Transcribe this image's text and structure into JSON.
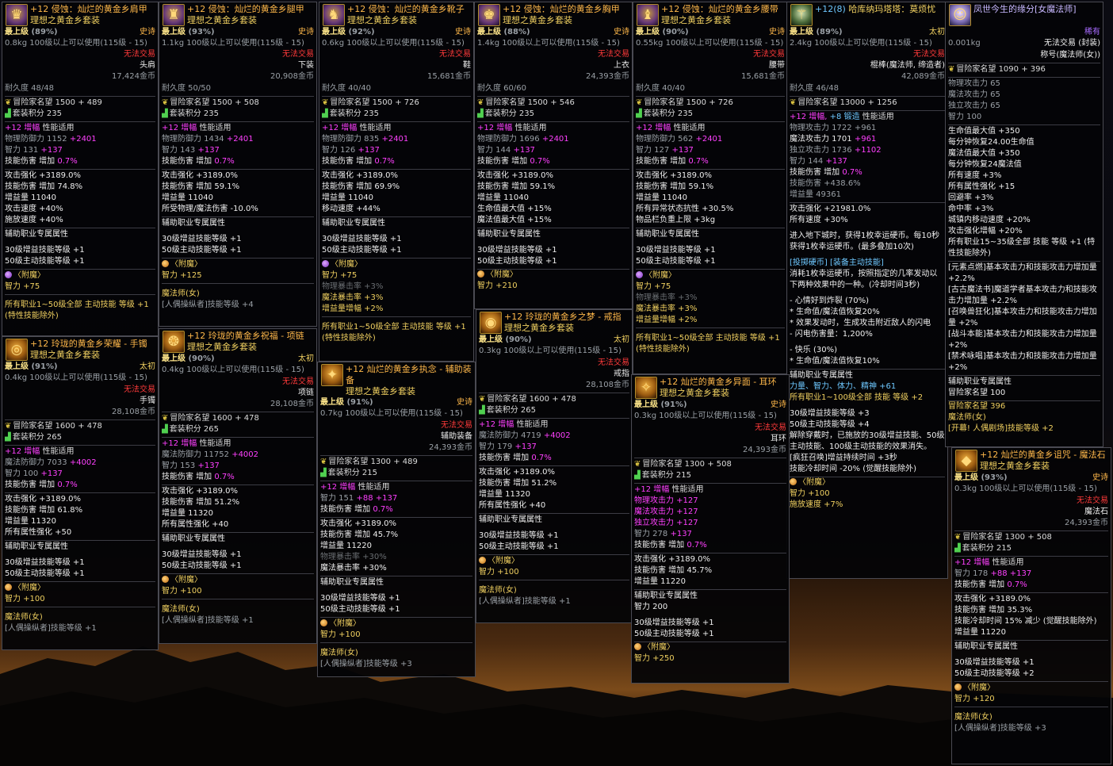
{
  "shoulder": {
    "name": "+12 侵蚀：灿烂的黄金乡肩甲",
    "set": "理想之黄金乡套装",
    "grade": "最上级",
    "grade_pct": "(89%)",
    "rarity": "史诗",
    "weight": "0.8kg",
    "req": "100级以上可以使用(115级 - 15)",
    "trade": "无法交易",
    "slot": "头肩",
    "price": "17,424金币",
    "dur": "耐久度 48/48",
    "fame": "冒险家名望 1500 + 489",
    "setpts": "套装积分 235",
    "amp_a": "+12 增幅",
    "amp_b": "性能适用",
    "def_l": "物理防御力 1152",
    "def_b": "+2401",
    "int_l": "智力 131",
    "int_b": "+137",
    "skd_l": "技能伤害 增加",
    "skd_b": "0.7%",
    "s1": "攻击强化 +3189.0%",
    "s2": "技能伤害 增加 74.8%",
    "s3": "增益量 11040",
    "s4": "攻击速度 +40%",
    "s5": "施放速度 +40%",
    "aux": "辅助职业专属属性",
    "b1": "30级增益技能等级 +1",
    "b2": "50级主动技能等级 +1",
    "ench": "〈附魔〉",
    "ench_v": "智力 +75",
    "all": "所有职业1~50级全部 主动技能 等级 +1 (特性技能除外)"
  },
  "legs": {
    "name": "+12 侵蚀：灿烂的黄金乡腿甲",
    "set": "理想之黄金乡套装",
    "grade": "最上级",
    "grade_pct": "(93%)",
    "rarity": "史诗",
    "weight": "1.1kg",
    "req": "100级以上可以使用(115级 - 15)",
    "trade": "无法交易",
    "slot": "下装",
    "price": "20,908金币",
    "dur": "耐久度 50/50",
    "fame": "冒险家名望 1500 + 508",
    "setpts": "套装积分 235",
    "amp_a": "+12 增幅",
    "amp_b": "性能适用",
    "def_l": "物理防御力 1434",
    "def_b": "+2401",
    "int_l": "智力 143",
    "int_b": "+137",
    "skd_l": "技能伤害 增加",
    "skd_b": "0.7%",
    "s1": "攻击强化 +3189.0%",
    "s2": "技能伤害 增加 59.1%",
    "s3": "增益量 11040",
    "s4": "所受物理/魔法伤害 -10.0%",
    "aux": "辅助职业专属属性",
    "b1": "30级增益技能等级 +1",
    "b2": "50级主动技能等级 +1",
    "ench": "〈附魔〉",
    "ench_v": "智力 +125",
    "job": "魔法师(女)",
    "job2": "[人偶操纵者]技能等级 +4"
  },
  "shoes": {
    "name": "+12 侵蚀：灿烂的黄金乡靴子",
    "set": "理想之黄金乡套装",
    "grade": "最上级",
    "grade_pct": "(92%)",
    "rarity": "史诗",
    "weight": "0.6kg",
    "req": "100级以上可以使用(115级 - 15)",
    "trade": "无法交易",
    "slot": "鞋",
    "price": "15,681金币",
    "dur": "耐久度 40/40",
    "fame": "冒险家名望 1500 + 726",
    "setpts": "套装积分 235",
    "amp_a": "+12 增幅",
    "amp_b": "性能适用",
    "def_l": "物理防御力 835",
    "def_b": "+2401",
    "int_l": "智力 126",
    "int_b": "+137",
    "skd_l": "技能伤害 增加",
    "skd_b": "0.7%",
    "s1": "攻击强化 +3189.0%",
    "s2": "技能伤害 增加 69.9%",
    "s3": "增益量 11040",
    "s4": "移动速度 +44%",
    "aux": "辅助职业专属属性",
    "b1": "30级增益技能等级 +1",
    "b2": "50级主动技能等级 +1",
    "ench": "〈附魔〉",
    "ench_v": "智力 +75",
    "e2": "物理暴击率 +3%",
    "e3": "魔法暴击率 +3%",
    "e4": "增益量增幅 +2%",
    "all": "所有职业1~50级全部 主动技能 等级 +1 (特性技能除外)"
  },
  "chest": {
    "name": "+12 侵蚀：灿烂的黄金乡胸甲",
    "set": "理想之黄金乡套装",
    "grade": "最上级",
    "grade_pct": "(88%)",
    "rarity": "史诗",
    "weight": "1.4kg",
    "req": "100级以上可以使用(115级 - 15)",
    "trade": "无法交易",
    "slot": "上衣",
    "price": "24,393金币",
    "dur": "耐久度 60/60",
    "fame": "冒险家名望 1500 + 546",
    "setpts": "套装积分 235",
    "amp_a": "+12 增幅",
    "amp_b": "性能适用",
    "def_l": "物理防御力 1696",
    "def_b": "+2401",
    "int_l": "智力 144",
    "int_b": "+137",
    "skd_l": "技能伤害 增加",
    "skd_b": "0.7%",
    "s1": "攻击强化 +3189.0%",
    "s2": "技能伤害 增加 59.1%",
    "s3": "增益量 11040",
    "s4": "生命值最大值 +15%",
    "s5": "魔法值最大值 +15%",
    "aux": "辅助职业专属属性",
    "b1": "30级增益技能等级 +1",
    "b2": "50级主动技能等级 +1",
    "ench": "〈附魔〉",
    "ench_v": "智力 +210"
  },
  "belt": {
    "name": "+12 侵蚀：灿烂的黄金乡腰带",
    "set": "理想之黄金乡套装",
    "grade": "最上级",
    "grade_pct": "(90%)",
    "rarity": "史诗",
    "weight": "0.55kg",
    "req": "100级以上可以使用(115级 - 15)",
    "trade": "无法交易",
    "slot": "腰带",
    "price": "15,681金币",
    "dur": "耐久度 40/40",
    "fame": "冒险家名望 1500 + 726",
    "setpts": "套装积分 235",
    "amp_a": "+12 增幅",
    "amp_b": "性能适用",
    "def_l": "物理防御力 562",
    "def_b": "+2401",
    "int_l": "智力 127",
    "int_b": "+137",
    "skd_l": "技能伤害 增加",
    "skd_b": "0.7%",
    "s1": "攻击强化 +3189.0%",
    "s2": "技能伤害 增加 59.1%",
    "s3": "增益量 11040",
    "s4": "所有异常状态抗性 +30.5%",
    "s5": "物品栏负重上限 +3kg",
    "aux": "辅助职业专属属性",
    "b1": "30级增益技能等级 +1",
    "b2": "50级主动技能等级 +1",
    "ench": "〈附魔〉",
    "ench_v": "智力 +75",
    "e2": "物理暴击率 +3%",
    "e3": "魔法暴击率 +3%",
    "e4": "增益量增幅 +2%",
    "all": "所有职业1~50级全部 主动技能 等级 +1 (特性技能除外)"
  },
  "weapon": {
    "name_a": "+12(8)",
    "name_b": "哈库纳玛塔塔：莫烦忧",
    "grade": "最上级",
    "grade_pct": "(89%)",
    "rarity": "太初",
    "weight": "2.4kg",
    "req": "100级以上可以使用(115级 - 15)",
    "trade": "无法交易",
    "slot": "棍棒(魔法师, 缔造者)",
    "price": "42,089金币",
    "dur": "耐久度 46/48",
    "fame": "冒险家名望 13000 + 1256",
    "amp_a": "+12 增幅,",
    "amp_m": "+8 锻造",
    "amp_b": "性能适用",
    "p1_l": "物理攻击力 1722",
    "p1_b": "+961",
    "p2_l": "魔法攻击力 1701",
    "p2_b": "+961",
    "p3_l": "独立攻击力 1736",
    "p3_b": "+1102",
    "p4_l": "智力 144",
    "p4_b": "+137",
    "p5_l": "技能伤害 增加",
    "p5_b": "0.7%",
    "p6": "技能伤害 +438.6%",
    "p7": "增益量 49361",
    "s1": "攻击强化 +21981.0%",
    "s2": "所有速度 +30%",
    "d1": "进入地下城时，获得1枚幸运硬币。每10秒获得1枚幸运硬币。(最多叠加10次)",
    "d2": "[投掷硬币] [装备主动技能]",
    "d3": "消耗1枚幸运硬币，按照指定的几率发动以下两种效果中的一种。(冷却时间3秒)",
    "d4": "- 心情好到炸裂 (70%)",
    "d5": "* 生命值/魔法值恢复20%",
    "d6": "* 效果发动时，生成攻击附近敌人的闪电",
    "d7": "- 闪电伤害量：1,200%",
    "d8": "- 快乐 (30%)",
    "d9": "* 生命值/魔法值恢复10%",
    "aux": "辅助职业专属属性",
    "x1": "力量、智力、体力、精神 +61",
    "x2": "所有职业1~100级全部 技能 等级 +2",
    "b1": "30级增益技能等级 +3",
    "b2": "50级主动技能等级 +4",
    "f1": "解除穿戴时，已施放的30级增益技能、50级主动技能、100级主动技能的效果消失。",
    "f2": "[疯狂召唤]增益持续时间 +3秒",
    "f3": "技能冷却时间 -20% (觉醒技能除外)",
    "ench": "〈附魔〉",
    "ench_v": "智力 +100",
    "ench_v2": "施放速度 +7%"
  },
  "title": {
    "name": "凤世今生的缘分[女魔法师]",
    "rarity": "稀有",
    "trade": "无法交易 (封装)",
    "weight": "0.001kg",
    "slot": "称号(魔法师(女))",
    "fame": "冒险家名望 1090 + 396",
    "p1": "物理攻击力 65",
    "p2": "魔法攻击力 65",
    "p3": "独立攻击力 65",
    "p4": "智力 100",
    "s1": "生命值最大值 +350",
    "s2": "每分钟恢复24.00生命值",
    "s3": "魔法值最大值 +350",
    "s4": "每分钟恢复24魔法值",
    "s5": "所有速度 +3%",
    "s6": "所有属性强化 +15",
    "s7": "回避率 +3%",
    "s8": "命中率 +3%",
    "s9": "城镇内移动速度 +20%",
    "s10": "攻击强化增幅 +20%",
    "s11": "所有职业15~35级全部 技能 等级 +1 (特性技能除外)",
    "t1": "[元素点燃]基本攻击力和技能攻击力增加量 +2.2%",
    "t2": "[古古魔法书]魔道学者基本攻击力和技能攻击力增加量 +2.2%",
    "t3": "[召唤兽狂化]基本攻击力和技能攻击力增加量 +2%",
    "t4": "[战斗本能]基本攻击力和技能攻击力增加量 +2%",
    "t5": "[禁术咏唱]基本攻击力和技能攻击力增加量 +2%",
    "aux": "辅助职业专属属性",
    "a1": "冒险家名望 100",
    "a2": "冒险家名望 396",
    "job": "魔法师(女)",
    "job2": "[开幕! 人偶剧场]技能等级 +2"
  },
  "bracelet": {
    "name": "+12 玲珑的黄金乡荣耀 - 手镯",
    "set": "理想之黄金乡套装",
    "grade": "最上级",
    "grade_pct": "(91%)",
    "rarity": "太初",
    "weight": "0.4kg",
    "req": "100级以上可以使用(115级 - 15)",
    "trade": "无法交易",
    "slot": "手镯",
    "price": "28,108金币",
    "fame": "冒险家名望 1600 + 478",
    "setpts": "套装积分 265",
    "amp_a": "+12 增幅",
    "amp_b": "性能适用",
    "p1_l": "魔法防御力 7033",
    "p1_b": "+4002",
    "p2_l": "智力 100",
    "p2_b": "+137",
    "p3_l": "技能伤害 增加",
    "p3_b": "0.7%",
    "s1": "攻击强化 +3189.0%",
    "s2": "技能伤害 增加 61.8%",
    "s3": "增益量 11320",
    "s4": "所有属性强化 +50",
    "aux": "辅助职业专属属性",
    "b1": "30级增益技能等级 +1",
    "b2": "50级主动技能等级 +1",
    "ench": "〈附魔〉",
    "ench_v": "智力 +100",
    "job": "魔法师(女)",
    "job2": "[人偶操纵者]技能等级 +1"
  },
  "necklace": {
    "name": "+12 玲珑的黄金乡祝福 - 项链",
    "set": "理想之黄金乡套装",
    "grade": "最上级",
    "grade_pct": "(90%)",
    "rarity": "太初",
    "weight": "0.4kg",
    "req": "100级以上可以使用(115级 - 15)",
    "trade": "无法交易",
    "slot": "项链",
    "price": "28,108金币",
    "fame": "冒险家名望 1600 + 478",
    "setpts": "套装积分 265",
    "amp_a": "+12 增幅",
    "amp_b": "性能适用",
    "p1_l": "魔法防御力 11752",
    "p1_b": "+4002",
    "p2_l": "智力 153",
    "p2_b": "+137",
    "p3_l": "技能伤害 增加",
    "p3_b": "0.7%",
    "s1": "攻击强化 +3189.0%",
    "s2": "技能伤害 增加 51.2%",
    "s3": "增益量 11320",
    "s4": "所有属性强化 +40",
    "aux": "辅助职业专属属性",
    "b1": "30级增益技能等级 +1",
    "b2": "50级主动技能等级 +1",
    "ench": "〈附魔〉",
    "ench_v": "智力 +100",
    "job": "魔法师(女)",
    "job2": "[人偶操纵者]技能等级 +1"
  },
  "subequip": {
    "name": "+12 灿烂的黄金乡执念 - 辅助装备",
    "set": "理想之黄金乡套装",
    "grade": "最上级",
    "grade_pct": "(91%)",
    "rarity": "史诗",
    "weight": "0.7kg",
    "req": "100级以上可以使用(115级 - 15)",
    "trade": "无法交易",
    "slot": "辅助装备",
    "price": "24,393金币",
    "fame": "冒险家名望 1300 + 489",
    "setpts": "套装积分 215",
    "amp_a": "+12 增幅",
    "amp_b": "性能适用",
    "p1_l": "智力 151",
    "p1_m": "+88",
    "p1_b": "+137",
    "p2_l": "技能伤害 增加",
    "p2_b": "0.7%",
    "s1": "攻击强化 +3189.0%",
    "s2": "技能伤害 增加 45.7%",
    "s3": "增益量 11220",
    "s4": "物理暴击率 +30%",
    "s5": "魔法暴击率 +30%",
    "aux": "辅助职业专属属性",
    "b1": "30级增益技能等级 +1",
    "b2": "50级主动技能等级 +1",
    "ench": "〈附魔〉",
    "ench_v": "智力 +100",
    "job": "魔法师(女)",
    "job2": "[人偶操纵者]技能等级 +3"
  },
  "ring": {
    "name": "+12 玲珑的黄金乡之梦 - 戒指",
    "set": "理想之黄金乡套装",
    "grade": "最上级",
    "grade_pct": "(90%)",
    "rarity": "太初",
    "weight": "0.3kg",
    "req": "100级以上可以使用(115级 - 15)",
    "trade": "无法交易",
    "slot": "戒指",
    "price": "28,108金币",
    "fame": "冒险家名望 1600 + 478",
    "setpts": "套装积分 265",
    "amp_a": "+12 增幅",
    "amp_b": "性能适用",
    "p1_l": "魔法防御力 4719",
    "p1_b": "+4002",
    "p2_l": "智力 179",
    "p2_b": "+137",
    "p3_l": "技能伤害 增加",
    "p3_b": "0.7%",
    "s1": "攻击强化 +3189.0%",
    "s2": "技能伤害 增加 51.2%",
    "s3": "增益量 11320",
    "s4": "所有属性强化 +40",
    "aux": "辅助职业专属属性",
    "b1": "30级增益技能等级 +1",
    "b2": "50级主动技能等级 +1",
    "ench": "〈附魔〉",
    "ench_v": "智力 +100",
    "job": "魔法师(女)",
    "job2": "[人偶操纵者]技能等级 +1"
  },
  "earring": {
    "name": "+12 灿烂的黄金乡异面 - 耳环",
    "set": "理想之黄金乡套装",
    "grade": "最上级",
    "grade_pct": "(91%)",
    "rarity": "史诗",
    "weight": "0.3kg",
    "req": "100级以上可以使用(115级 - 15)",
    "trade": "无法交易",
    "slot": "耳环",
    "price": "24,393金币",
    "fame": "冒险家名望 1300 + 508",
    "setpts": "套装积分 215",
    "amp_a": "+12 增幅",
    "amp_b": "性能适用",
    "p1": "物理攻击力 +127",
    "p2": "魔法攻击力 +127",
    "p3": "独立攻击力 +127",
    "p4_l": "智力 278",
    "p4_b": "+137",
    "p5_l": "技能伤害 增加",
    "p5_b": "0.7%",
    "s1": "攻击强化 +3189.0%",
    "s2": "技能伤害 增加 45.7%",
    "s3": "增益量 11220",
    "aux": "辅助职业专属属性",
    "a1": "智力 200",
    "b1": "30级增益技能等级 +1",
    "b2": "50级主动技能等级 +1",
    "ench": "〈附魔〉",
    "ench_v": "智力 +250"
  },
  "magicstone": {
    "name": "+12 灿烂的黄金乡诅咒 - 魔法石",
    "set": "理想之黄金乡套装",
    "grade": "最上级",
    "grade_pct": "(93%)",
    "rarity": "史诗",
    "weight": "0.3kg",
    "req": "100级以上可以使用(115级 - 15)",
    "trade": "无法交易",
    "slot": "魔法石",
    "price": "24,393金币",
    "fame": "冒险家名望 1300 + 508",
    "setpts": "套装积分 215",
    "amp_a": "+12 增幅",
    "amp_b": "性能适用",
    "p1_l": "智力 178",
    "p1_m": "+88",
    "p1_b": "+137",
    "p2_l": "技能伤害 增加",
    "p2_b": "0.7%",
    "s1": "攻击强化 +3189.0%",
    "s2": "技能伤害 增加 35.3%",
    "s3": "技能冷却时间 15% 减少 (觉醒技能除外)",
    "s4": "增益量 11220",
    "aux": "辅助职业专属属性",
    "b1": "30级增益技能等级 +1",
    "b2": "50级主动技能等级 +2",
    "ench": "〈附魔〉",
    "ench_v": "智力 +120",
    "job": "魔法师(女)",
    "job2": "[人偶操纵者]技能等级 +3"
  }
}
